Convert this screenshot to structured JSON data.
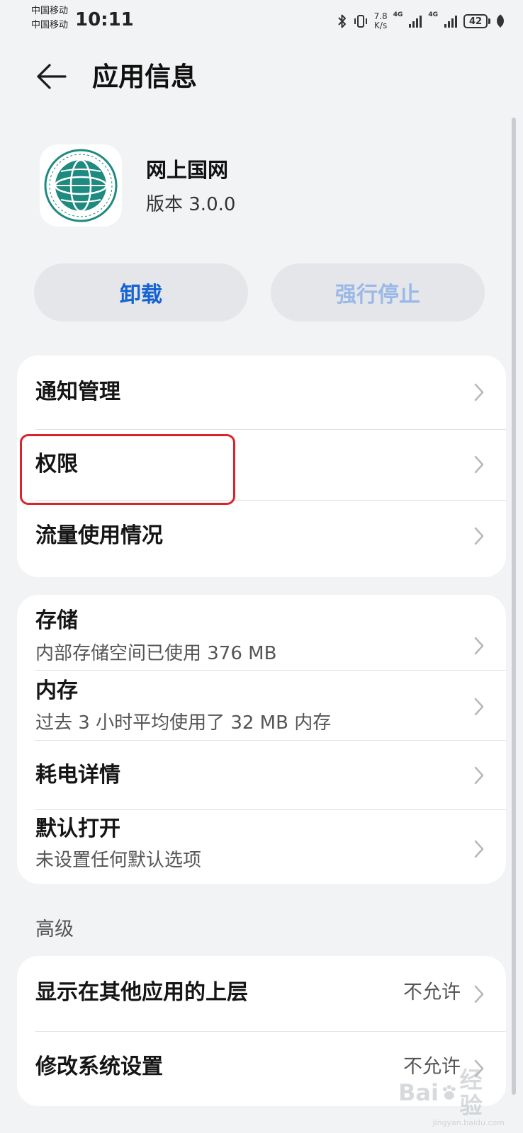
{
  "status_bar": {
    "carrier_1": "中国移动",
    "carrier_2": "中国移动",
    "time": "10:11",
    "net_speed_value": "7.8",
    "net_speed_unit": "K/s",
    "sim1_network": "4G",
    "sim2_network": "4G",
    "battery_level": "42",
    "icons": [
      "bluetooth-icon",
      "vibrate-icon",
      "signal-icon",
      "battery-icon",
      "leaf-icon"
    ]
  },
  "header": {
    "back_icon": "back-arrow-icon",
    "title": "应用信息"
  },
  "app": {
    "name": "网上国网",
    "version": "版本 3.0.0",
    "icon_colors": {
      "primary": "#1f8a7f",
      "background": "#ffffff"
    }
  },
  "actions": {
    "uninstall": "卸载",
    "force_stop": "强行停止"
  },
  "card_1": {
    "items": [
      {
        "title": "通知管理"
      },
      {
        "title": "权限"
      },
      {
        "title": "流量使用情况"
      }
    ]
  },
  "card_2": {
    "items": [
      {
        "title": "存储",
        "subtitle": "内部存储空间已使用 376 MB"
      },
      {
        "title": "内存",
        "subtitle": "过去 3 小时平均使用了 32 MB 内存"
      },
      {
        "title": "耗电详情"
      },
      {
        "title": "默认打开",
        "subtitle": "未设置任何默认选项"
      }
    ]
  },
  "advanced": {
    "label": "高级",
    "items": [
      {
        "title": "显示在其他应用的上层",
        "value": "不允许"
      },
      {
        "title": "修改系统设置",
        "value": "不允许"
      }
    ]
  },
  "colors": {
    "accent": "#1463d3",
    "disabled_accent": "#9ab8e8",
    "highlight": "#d9232d",
    "page_bg": "#f1f3f5"
  }
}
